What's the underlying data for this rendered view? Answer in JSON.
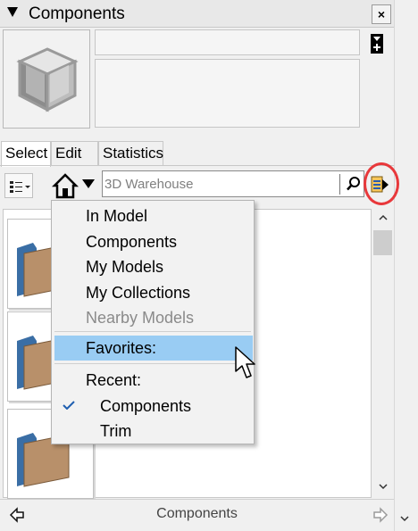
{
  "panel": {
    "title": "Components",
    "close_label": "×"
  },
  "tabs": [
    {
      "label": "Select",
      "active": true
    },
    {
      "label": "Edit",
      "active": false
    },
    {
      "label": "Statistics",
      "active": false
    }
  ],
  "search": {
    "placeholder": "3D Warehouse",
    "value": ""
  },
  "menu": {
    "items": [
      {
        "label": "In Model",
        "disabled": false
      },
      {
        "label": "Components",
        "disabled": false
      },
      {
        "label": "My Models",
        "disabled": false
      },
      {
        "label": "My Collections",
        "disabled": false
      },
      {
        "label": "Nearby Models",
        "disabled": true
      }
    ],
    "favorites_label": "Favorites:",
    "recent_label": "Recent:",
    "recent_items": [
      {
        "label": "Components",
        "checked": true
      },
      {
        "label": "Trim",
        "checked": false
      }
    ]
  },
  "footer": {
    "title": "Components"
  },
  "colors": {
    "accent_highlight": "#99ccf3",
    "annotation_circle": "#e8383b",
    "folder": "#b8906a"
  }
}
